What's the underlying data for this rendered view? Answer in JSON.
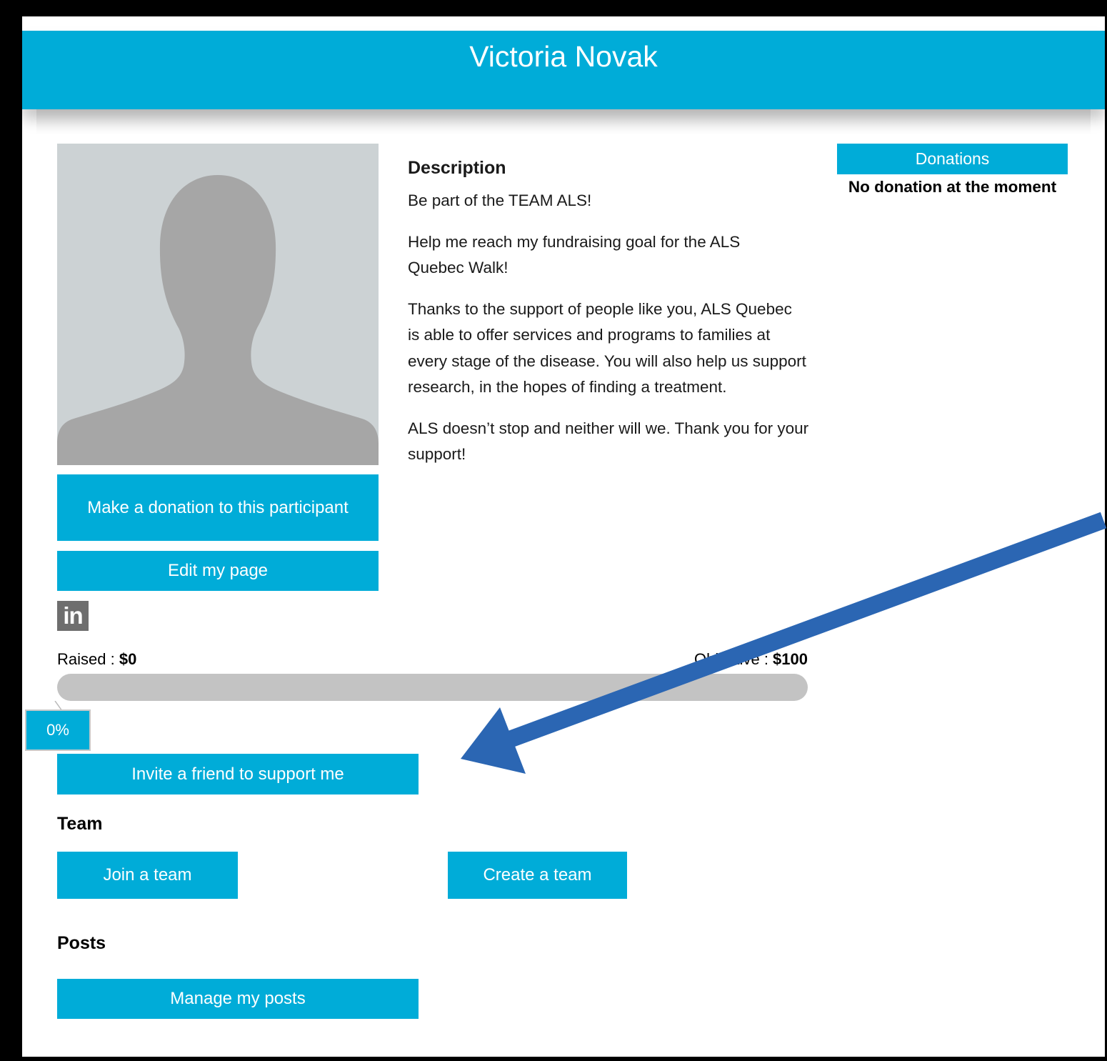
{
  "header": {
    "title": "Victoria Novak"
  },
  "profile": {
    "avatar_icon": "person-silhouette-icon"
  },
  "actions": {
    "donate_label": "Make a donation to this participant",
    "edit_label": "Edit my page",
    "invite_label": "Invite a friend to support me",
    "join_team_label": "Join a team",
    "create_team_label": "Create a team",
    "manage_posts_label": "Manage my posts"
  },
  "social": {
    "linkedin_icon": "linkedin-icon",
    "linkedin_text": "in"
  },
  "description": {
    "heading": "Description",
    "paragraphs": [
      "Be part of the TEAM ALS!",
      "Help me reach my fundraising goal for the ALS Quebec Walk!",
      "Thanks to the support of people like you, ALS Quebec is able to offer services and programs to families at every stage of the disease. You will also help us support research, in the hopes of finding a treatment.",
      "ALS doesn’t stop and neither will we. Thank you for your support!"
    ]
  },
  "donations": {
    "heading": "Donations",
    "empty_text": "No donation at the moment"
  },
  "fundraising": {
    "raised_label": "Raised : ",
    "raised_value": "$0",
    "objective_label": "Objective : ",
    "objective_value": "$100",
    "progress_percent_text": "0%",
    "progress_fraction": 0
  },
  "sections": {
    "team_title": "Team",
    "posts_title": "Posts"
  },
  "colors": {
    "accent": "#00acd8",
    "progress_track": "#c3c3c3",
    "annotation_arrow": "#2b66b3"
  },
  "annotation": {
    "arrow_icon": "annotation-arrow-icon"
  }
}
